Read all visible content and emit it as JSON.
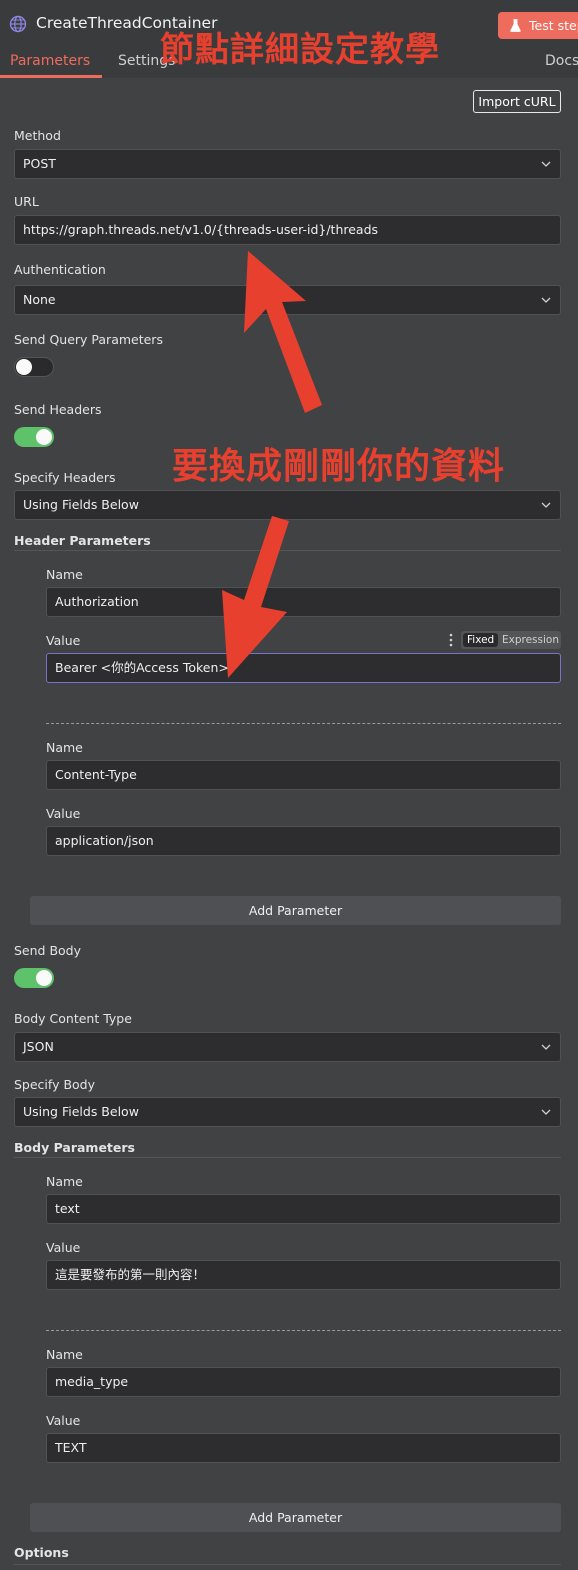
{
  "header": {
    "node_title": "CreateThreadContainer",
    "test_step_label": "Test step",
    "tabs": [
      "Parameters",
      "Settings",
      "Docs"
    ]
  },
  "import_curl_label": "Import cURL",
  "method": {
    "label": "Method",
    "value": "POST"
  },
  "url": {
    "label": "URL",
    "value": "https://graph.threads.net/v1.0/{threads-user-id}/threads"
  },
  "authentication": {
    "label": "Authentication",
    "value": "None"
  },
  "send_query_parameters": {
    "label": "Send Query Parameters",
    "enabled": false
  },
  "send_headers": {
    "label": "Send Headers",
    "enabled": true
  },
  "specify_headers": {
    "label": "Specify Headers",
    "value": "Using Fields Below"
  },
  "header_parameters": {
    "label": "Header Parameters",
    "items": [
      {
        "name_label": "Name",
        "name": "Authorization",
        "value_label": "Value",
        "value": "Bearer <你的Access Token>"
      },
      {
        "name_label": "Name",
        "name": "Content-Type",
        "value_label": "Value",
        "value": "application/json"
      }
    ],
    "add_label": "Add Parameter"
  },
  "value_mode": {
    "fixed": "Fixed",
    "expression": "Expression"
  },
  "send_body": {
    "label": "Send Body",
    "enabled": true
  },
  "body_content_type": {
    "label": "Body Content Type",
    "value": "JSON"
  },
  "specify_body": {
    "label": "Specify Body",
    "value": "Using Fields Below"
  },
  "body_parameters": {
    "label": "Body Parameters",
    "items": [
      {
        "name_label": "Name",
        "name": "text",
        "value_label": "Value",
        "value": "這是要發布的第一則內容！"
      },
      {
        "name_label": "Name",
        "name": "media_type",
        "value_label": "Value",
        "value": "TEXT"
      }
    ],
    "add_label": "Add Parameter"
  },
  "options_label": "Options",
  "annotations": {
    "title": "節點詳細設定教學",
    "replace_note": "要換成剛剛你的資料"
  },
  "colors": {
    "accent": "#ee6c5d",
    "annotation": "#e8402f",
    "toggle_on": "#5ec26a"
  }
}
